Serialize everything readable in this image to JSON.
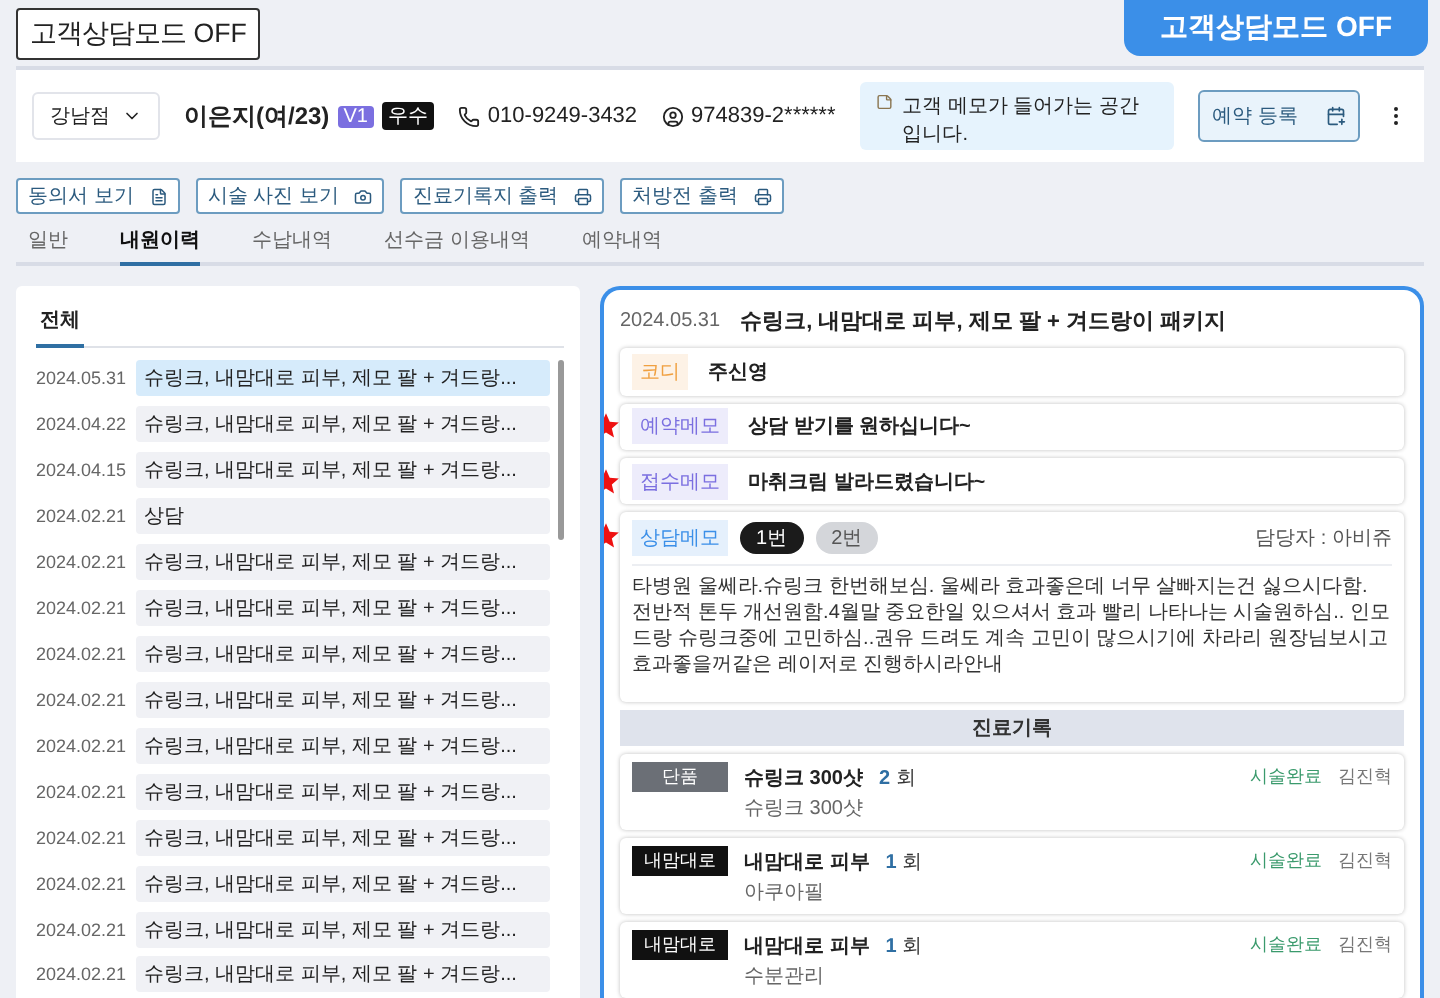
{
  "mode_button": "고객상담모드 OFF",
  "mode_callout": "고객상담모드 OFF",
  "customer": {
    "branch": "강남점",
    "name": "이은지(여/23)",
    "badges": [
      {
        "label": "V1",
        "color": "#7b6fe0"
      },
      {
        "label": "우수",
        "color": "#111111"
      }
    ],
    "phone": "010-9249-3432",
    "id_number": "974839-2******",
    "memo": "고객 메모가 들어가는 공간입니다.",
    "reserve_button": "예약 등록"
  },
  "actions": [
    {
      "label": "동의서 보기",
      "kind": "document"
    },
    {
      "label": "시술 사진 보기",
      "kind": "camera"
    },
    {
      "label": "진료기록지 출력",
      "kind": "print"
    },
    {
      "label": "처방전 출력",
      "kind": "print"
    }
  ],
  "tabs": [
    {
      "label": "일반",
      "selected": false
    },
    {
      "label": "내원이력",
      "selected": true
    },
    {
      "label": "수납내역",
      "selected": false
    },
    {
      "label": "선수금 이용내역",
      "selected": false
    },
    {
      "label": "예약내역",
      "selected": false
    }
  ],
  "visit_list": {
    "filters": [
      {
        "label": "전체",
        "selected": true
      }
    ],
    "rows": [
      {
        "date": "2024.05.31",
        "summary": "슈링크, 내맘대로 피부, 제모 팔 + 겨드랑...",
        "selected": true
      },
      {
        "date": "2024.04.22",
        "summary": "슈링크, 내맘대로 피부, 제모 팔 + 겨드랑...",
        "selected": false
      },
      {
        "date": "2024.04.15",
        "summary": "슈링크, 내맘대로 피부, 제모 팔 + 겨드랑...",
        "selected": false
      },
      {
        "date": "2024.02.21",
        "summary": "상담",
        "selected": false
      },
      {
        "date": "2024.02.21",
        "summary": "슈링크, 내맘대로 피부, 제모 팔 + 겨드랑...",
        "selected": false
      },
      {
        "date": "2024.02.21",
        "summary": "슈링크, 내맘대로 피부, 제모 팔 + 겨드랑...",
        "selected": false
      },
      {
        "date": "2024.02.21",
        "summary": "슈링크, 내맘대로 피부, 제모 팔 + 겨드랑...",
        "selected": false
      },
      {
        "date": "2024.02.21",
        "summary": "슈링크, 내맘대로 피부, 제모 팔 + 겨드랑...",
        "selected": false
      },
      {
        "date": "2024.02.21",
        "summary": "슈링크, 내맘대로 피부, 제모 팔 + 겨드랑...",
        "selected": false
      },
      {
        "date": "2024.02.21",
        "summary": "슈링크, 내맘대로 피부, 제모 팔 + 겨드랑...",
        "selected": false
      },
      {
        "date": "2024.02.21",
        "summary": "슈링크, 내맘대로 피부, 제모 팔 + 겨드랑...",
        "selected": false
      },
      {
        "date": "2024.02.21",
        "summary": "슈링크, 내맘대로 피부, 제모 팔 + 겨드랑...",
        "selected": false
      },
      {
        "date": "2024.02.21",
        "summary": "슈링크, 내맘대로 피부, 제모 팔 + 겨드랑...",
        "selected": false
      },
      {
        "date": "2024.02.21",
        "summary": "슈링크, 내맘대로 피부, 제모 팔 + 겨드랑...",
        "selected": false
      }
    ]
  },
  "detail": {
    "date": "2024.05.31",
    "title": "슈링크, 내맘대로 피부, 제모 팔 + 겨드랑이 패키지",
    "memos": [
      {
        "label": "코디",
        "color": "#f0a040",
        "text": "주신영",
        "starred": false
      },
      {
        "label": "예약메모",
        "color": "#7b6fe0",
        "text": "상담 받기를 원하십니다~",
        "starred": true
      },
      {
        "label": "접수메모",
        "color": "#7b6fe0",
        "text": "마취크림 발라드렸습니다~",
        "starred": true
      }
    ],
    "consult": {
      "label": "상담메모",
      "starred": true,
      "pages": [
        {
          "label": "1번",
          "selected": true
        },
        {
          "label": "2번",
          "selected": false
        }
      ],
      "manager": "담당자 : 아비쥬",
      "text": "타병원 울쎄라.슈링크 한번해보심. 울쎄라 효과좋은데 너무 살빠지는건 싫으시다함. 전반적 톤두 개선원함.4월말 중요한일 있으셔서 효과 빨리 나타나는 시술원하심.. 인모드랑 슈링크중에 고민하심..권유 드려도 계속 고민이 많으시기에 차라리 원장님보시고 효과좋을꺼같은 레이저로 진행하시라안내"
    },
    "records_title": "진료기록",
    "records": [
      {
        "category": "단품",
        "color": "#6b6f76",
        "name": "슈링크 300샷",
        "count": "2",
        "count_unit": "회",
        "detail": "슈링크 300샷",
        "status": "시술완료",
        "staff": "김진혁"
      },
      {
        "category": "내맘대로",
        "color": "#111111",
        "name": "내맘대로 피부",
        "count": "1",
        "count_unit": "회",
        "detail": "아쿠아필",
        "status": "시술완료",
        "staff": "김진혁"
      },
      {
        "category": "내맘대로",
        "color": "#111111",
        "name": "내맘대로 피부",
        "count": "1",
        "count_unit": "회",
        "detail": "수분관리",
        "status": "시술완료",
        "staff": "김진혁"
      }
    ]
  }
}
